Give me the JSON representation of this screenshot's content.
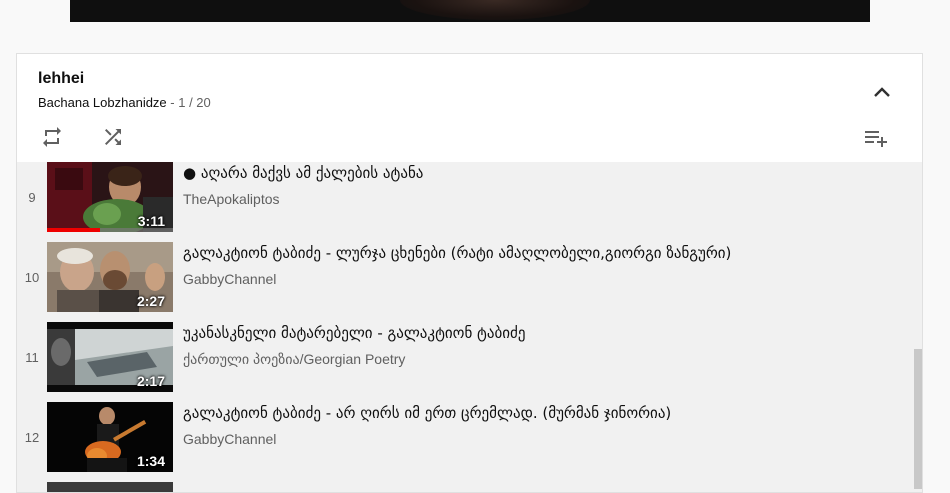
{
  "playlist": {
    "title": "lehhei",
    "owner": "Bachana Lobzhanidze",
    "separator": " - ",
    "position": "1 / 20"
  },
  "icons": {
    "collapse": "chevron-up-icon",
    "loop": "repeat-icon",
    "shuffle": "shuffle-icon",
    "save": "playlist-add-icon"
  },
  "colors": {
    "progress": "#ee0000",
    "panel_bg": "#ffffff",
    "list_bg": "#f1f1f1",
    "secondary_text": "#606060"
  },
  "items": [
    {
      "index": "9",
      "title": "● აღარა მაქვს ამ ქალების ატანა",
      "channel": "TheApokaliptos",
      "duration": "3:11",
      "watched_fraction": 0.42
    },
    {
      "index": "10",
      "title": "გალაკტიონ ტაბიძე - ლურჯა ცხენები (რატი ამაღლობელი,გიორგი ზანგური)",
      "channel": "GabbyChannel",
      "duration": "2:27"
    },
    {
      "index": "11",
      "title": "უკანასკნელი მატარებელი - გალაკტიონ ტაბიძე",
      "channel": "ქართული პოეზია/Georgian Poetry",
      "duration": "2:17"
    },
    {
      "index": "12",
      "title": "გალაკტიონ ტაბიძე - არ ღირს იმ ერთ ცრემლად. (მურმან ჯინორია)",
      "channel": "GabbyChannel",
      "duration": "1:34"
    }
  ]
}
